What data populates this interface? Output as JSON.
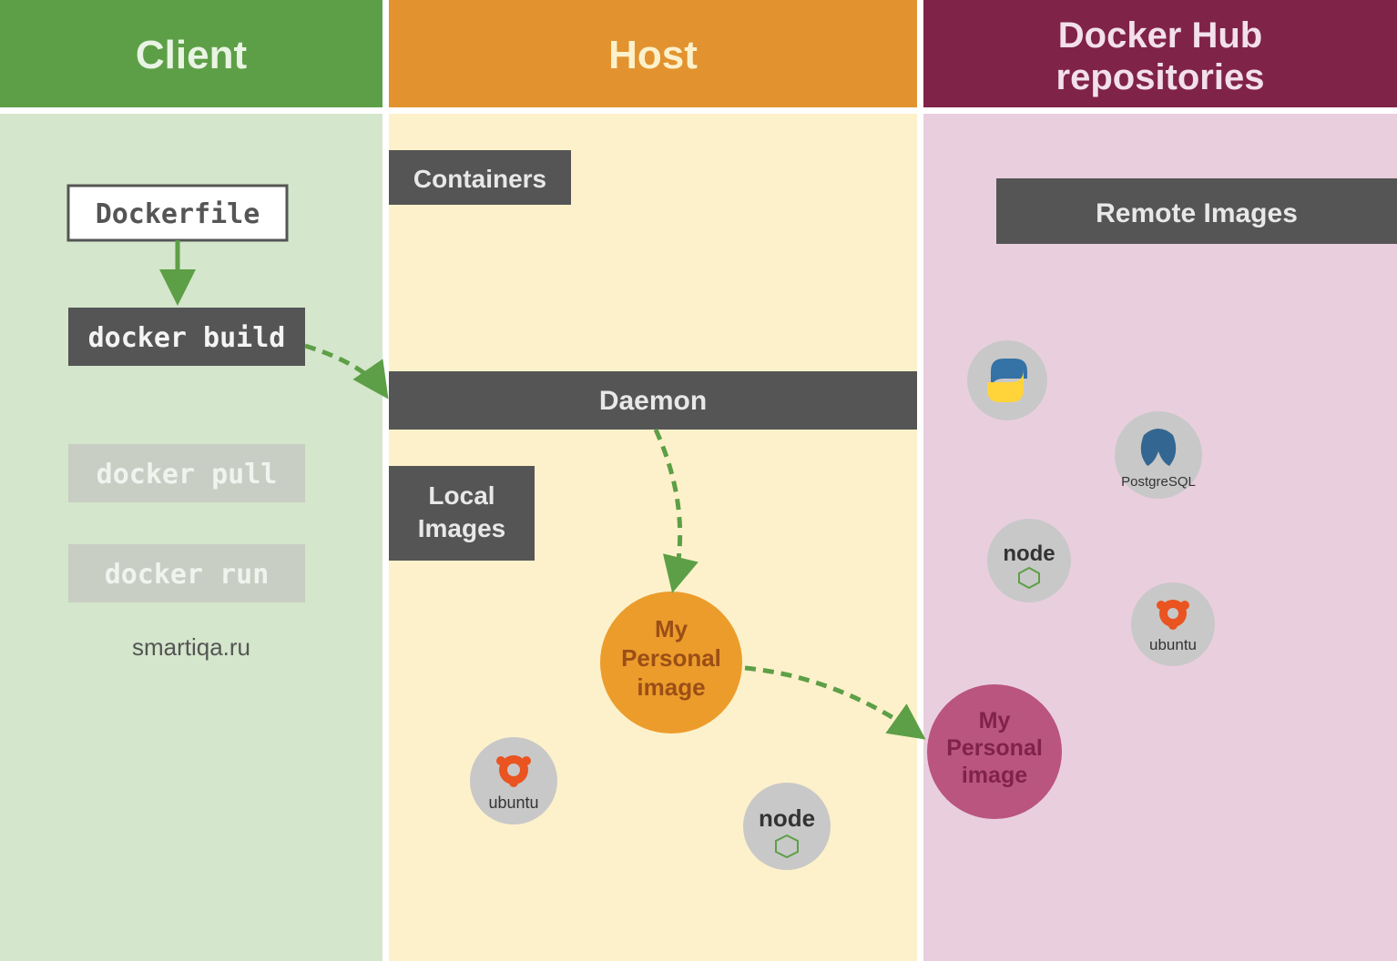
{
  "columns": {
    "client": {
      "title": "Client",
      "header_bg": "#5D9F46",
      "body_bg": "#D4E6CB"
    },
    "host": {
      "title": "Host",
      "header_bg": "#E2932F",
      "body_bg": "#FDF1CB"
    },
    "hub": {
      "title": "Docker Hub repositories",
      "header_bg": "#802348",
      "body_bg": "#E9CFDE"
    }
  },
  "labels": {
    "dockerfile": "Dockerfile",
    "docker_build": "docker build",
    "docker_pull": "docker pull",
    "docker_run": "docker run",
    "containers": "Containers",
    "daemon": "Daemon",
    "local_images": "Local Images",
    "remote_images": "Remote Images",
    "my_personal_image": "My Personal image",
    "footer": "smartiqa.ru"
  },
  "logos": {
    "ubuntu": "ubuntu",
    "node": "node",
    "python": "python",
    "postgresql": "PostgreSQL"
  },
  "colors": {
    "gray": "#555555",
    "gray_faded": "#C8CEC3",
    "green_arrow": "#5D9F46",
    "host_image_bg": "#EC9C2B",
    "host_image_text": "#9B4F16",
    "hub_image_bg": "#B9557F",
    "hub_image_text": "#802348",
    "logo_bg": "#C8C8C8"
  }
}
